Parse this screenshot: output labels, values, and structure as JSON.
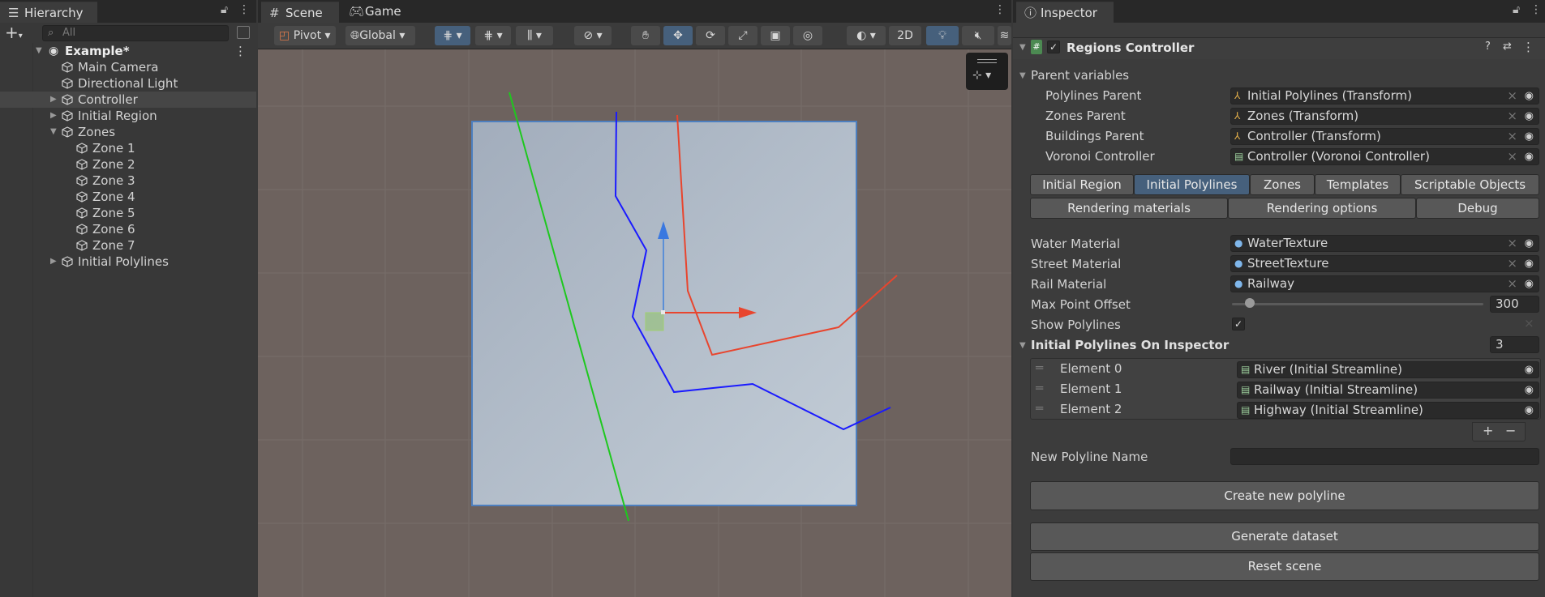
{
  "hierarchy": {
    "tab": "Hierarchy",
    "search_placeholder": "All",
    "scene_name": "Example*",
    "items": [
      "Main Camera",
      "Directional Light",
      "Controller",
      "Initial Region",
      "Zones",
      "Zone 1",
      "Zone 2",
      "Zone 3",
      "Zone 4",
      "Zone 5",
      "Zone 6",
      "Zone 7",
      "Initial Polylines"
    ]
  },
  "scene": {
    "tabs": [
      "Scene",
      "Game"
    ],
    "pivot": "Pivot",
    "global": "Global",
    "mode2d": "2D",
    "colors": {
      "green": "#1ec81e",
      "blue": "#1a1aff",
      "red": "#e8452e",
      "plane": "#a7b3c1"
    }
  },
  "inspector": {
    "tab": "Inspector",
    "component": "Regions Controller",
    "section_parent": "Parent variables",
    "parents": [
      {
        "label": "Polylines Parent",
        "value": "Initial Polylines (Transform)"
      },
      {
        "label": "Zones Parent",
        "value": "Zones (Transform)"
      },
      {
        "label": "Buildings Parent",
        "value": "Controller (Transform)"
      },
      {
        "label": "Voronoi Controller",
        "value": "Controller (Voronoi Controller)"
      }
    ],
    "tabs_row1": [
      "Initial Region",
      "Initial Polylines",
      "Zones",
      "Templates",
      "Scriptable Objects"
    ],
    "tabs_row2": [
      "Rendering materials",
      "Rendering options",
      "Debug"
    ],
    "materials": [
      {
        "label": "Water Material",
        "value": "WaterTexture"
      },
      {
        "label": "Street Material",
        "value": "StreetTexture"
      },
      {
        "label": "Rail Material",
        "value": "Railway"
      }
    ],
    "max_offset_label": "Max Point Offset",
    "max_offset_value": "300",
    "max_offset_fraction": 0.02,
    "show_polylines_label": "Show Polylines",
    "list_label": "Initial Polylines On Inspector",
    "list_count": "3",
    "elements": [
      {
        "label": "Element 0",
        "value": "River (Initial Streamline)"
      },
      {
        "label": "Element 1",
        "value": "Railway (Initial Streamline)"
      },
      {
        "label": "Element 2",
        "value": "Highway (Initial Streamline)"
      }
    ],
    "new_name_label": "New Polyline Name",
    "new_name_value": "",
    "create_button": "Create new polyline",
    "generate_button": "Generate dataset",
    "reset_button": "Reset scene"
  }
}
